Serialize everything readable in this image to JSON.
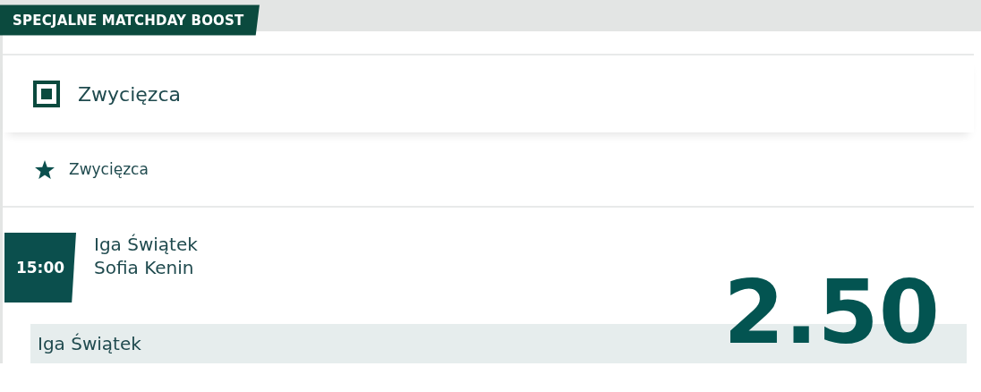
{
  "banner": {
    "title": "SPECJALNE MATCHDAY BOOST"
  },
  "market": {
    "title": "Zwycięzca"
  },
  "submarket": {
    "title": "Zwycięzca"
  },
  "event": {
    "time": "15:00",
    "players": [
      "Iga Świątek",
      "Sofia Kenin"
    ]
  },
  "selection": {
    "label": "Iga Świątek",
    "odds": "2.50"
  }
}
